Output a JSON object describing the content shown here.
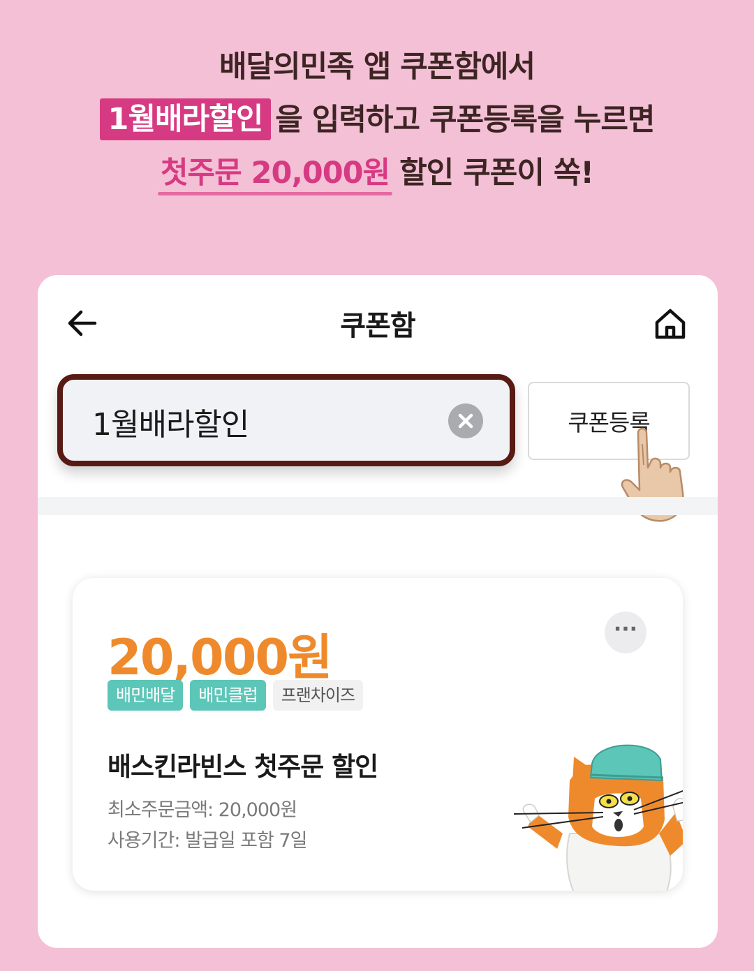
{
  "promo": {
    "line1": "배달의민족 앱 쿠폰함에서",
    "code_chip": "1월배라할인",
    "line2_rest": "을 입력하고 쿠폰등록을 누르면",
    "highlight": "첫주문 20,000원",
    "line3_rest": "할인 쿠폰이 쏙!"
  },
  "colors": {
    "background": "#f4c0d6",
    "accent_pink": "#d63a82",
    "amount_orange": "#ef8a2c",
    "tag_teal": "#5cc6b8",
    "input_border": "#571b14"
  },
  "app": {
    "title": "쿠폰함",
    "icons": {
      "back": "arrow-left-icon",
      "home": "home-icon",
      "clear": "close-circle-icon",
      "more": "more-dots-icon"
    },
    "code_input_value": "1월배라할인",
    "register_label": "쿠폰등록"
  },
  "coupon": {
    "amount": "20,000원",
    "more": "···",
    "tags": [
      "배민배달",
      "배민클럽",
      "프랜차이즈"
    ],
    "name": "배스킨라빈스 첫주문 할인",
    "min_order": "최소주문금액: 20,000원",
    "period": "사용기간: 발급일 포함 7일"
  }
}
